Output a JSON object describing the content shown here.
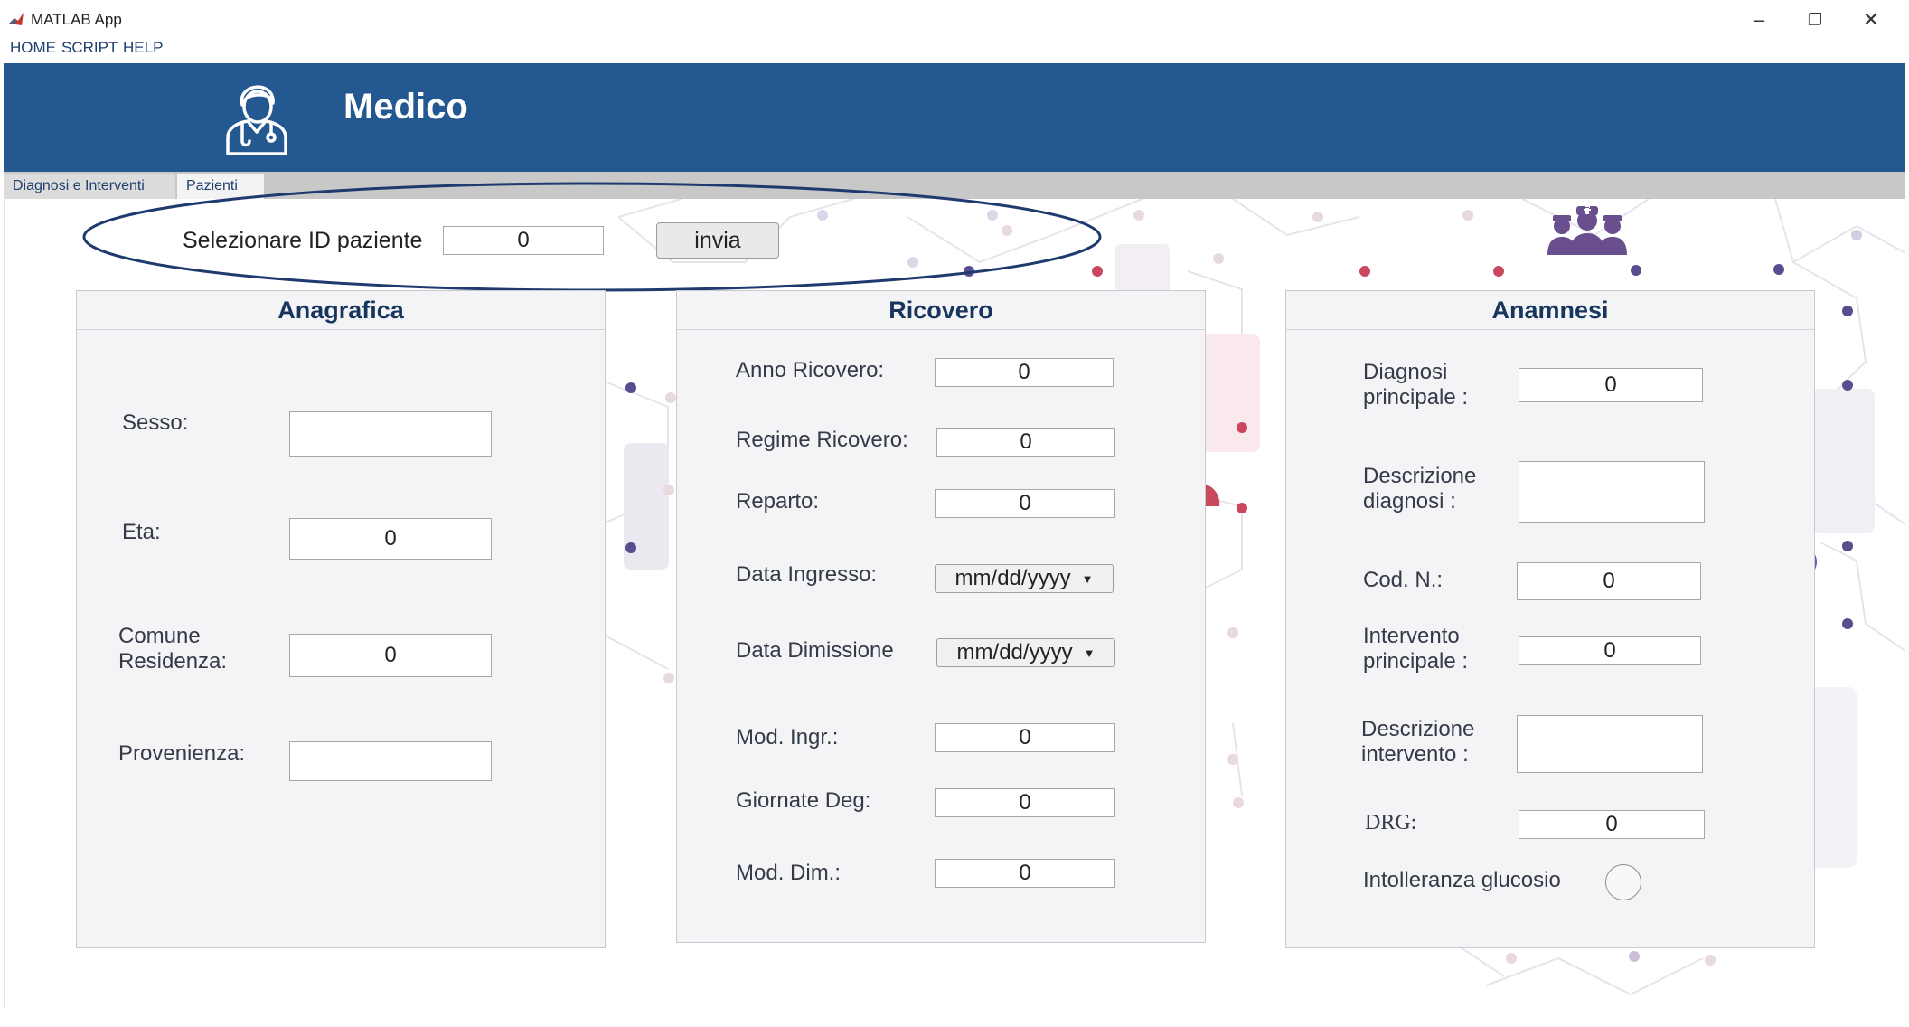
{
  "window": {
    "title": "MATLAB App",
    "minimize_glyph": "–",
    "restore_glyph": "❐",
    "close_glyph": "✕"
  },
  "menu": [
    "HOME",
    "SCRIPT",
    "HELP"
  ],
  "header": {
    "title": "Medico",
    "icon": "doctor-icon",
    "background": "#245890"
  },
  "tabs": [
    {
      "label": "Diagnosi e Interventi",
      "selected": false
    },
    {
      "label": "Pazienti",
      "selected": true
    }
  ],
  "selection": {
    "label": "Selezionare ID paziente",
    "value": "0",
    "button_label": "invia"
  },
  "anagrafica": {
    "title": "Anagrafica",
    "fields": [
      {
        "label": "Sesso:",
        "value": ""
      },
      {
        "label": "Eta:",
        "value": "0"
      },
      {
        "label": "Comune\nResidenza:",
        "value": "0"
      },
      {
        "label": "Provenienza:",
        "value": ""
      }
    ]
  },
  "ricovero": {
    "title": "Ricovero",
    "fields": [
      {
        "label": "Anno Ricovero:",
        "value": "0"
      },
      {
        "label": "Regime Ricovero:",
        "value": "0"
      },
      {
        "label": "Reparto:",
        "value": "0"
      },
      {
        "label": "Data Ingresso:",
        "value": "mm/dd/yyyy",
        "type": "date"
      },
      {
        "label": "Data Dimissione",
        "value": "mm/dd/yyyy",
        "type": "date"
      },
      {
        "label": "Mod. Ingr.:",
        "value": "0"
      },
      {
        "label": "Giornate Deg:",
        "value": "0"
      },
      {
        "label": "Mod. Dim.:",
        "value": "0"
      }
    ],
    "date_arrow": "▼"
  },
  "anamnesi": {
    "title": "Anamnesi",
    "fields": [
      {
        "label": "Diagnosi\nprincipale :",
        "value": "0"
      },
      {
        "label": "Descrizione\ndiagnosi :",
        "value": ""
      },
      {
        "label": "Cod. N.:",
        "value": "0"
      },
      {
        "label": "Intervento\nprincipale :",
        "value": "0"
      },
      {
        "label": "Descrizione\nintervento :",
        "value": ""
      },
      {
        "label": "DRG:",
        "value": "0"
      }
    ],
    "toggle_label": "Intolleranza glucosio",
    "toggle_on": false
  },
  "colors": {
    "accent": "#245890",
    "panel_title": "#17365d",
    "highlight_ellipse": "#1f3a6e"
  }
}
